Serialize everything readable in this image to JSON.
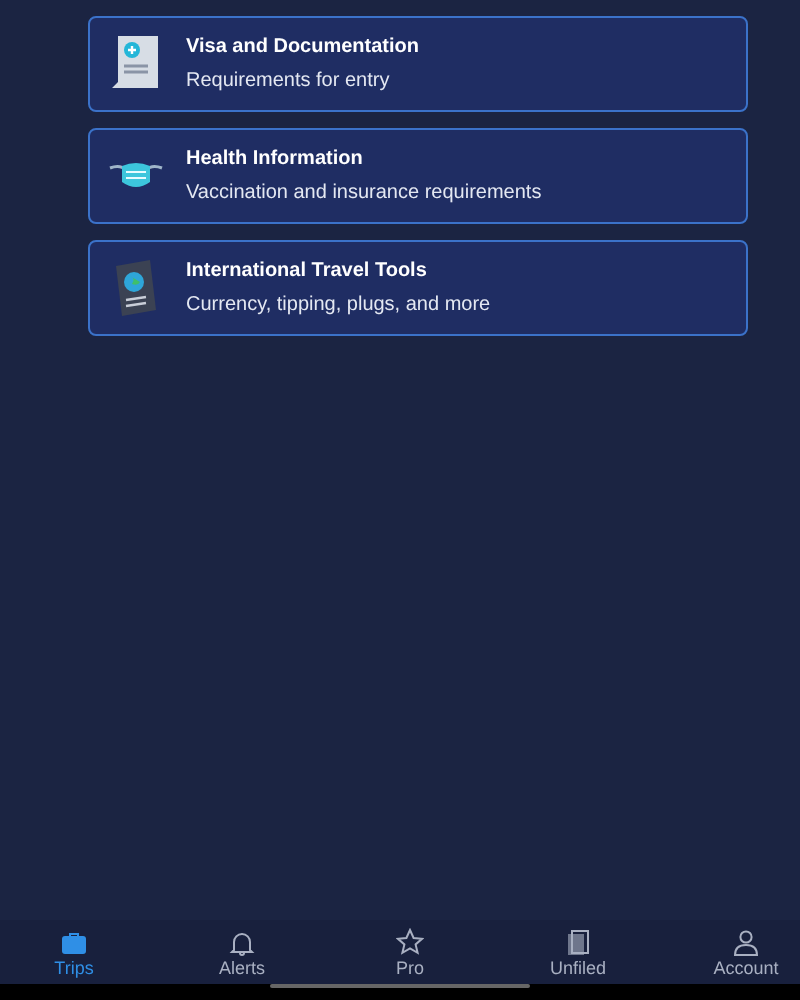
{
  "cards": [
    {
      "kind": "document",
      "title": "Visa and Documentation",
      "subtitle": "Requirements for entry"
    },
    {
      "kind": "mask",
      "title": "Health Information",
      "subtitle": "Vaccination and insurance requirements"
    },
    {
      "kind": "passport",
      "title": "International Travel Tools",
      "subtitle": "Currency, tipping, plugs, and more"
    }
  ],
  "tabs": [
    {
      "kind": "briefcase",
      "label": "Trips",
      "selected": true
    },
    {
      "kind": "bell",
      "label": "Alerts",
      "selected": false
    },
    {
      "kind": "star",
      "label": "Pro",
      "selected": false
    },
    {
      "kind": "files",
      "label": "Unfiled",
      "selected": false
    },
    {
      "kind": "person",
      "label": "Account",
      "selected": false
    }
  ]
}
